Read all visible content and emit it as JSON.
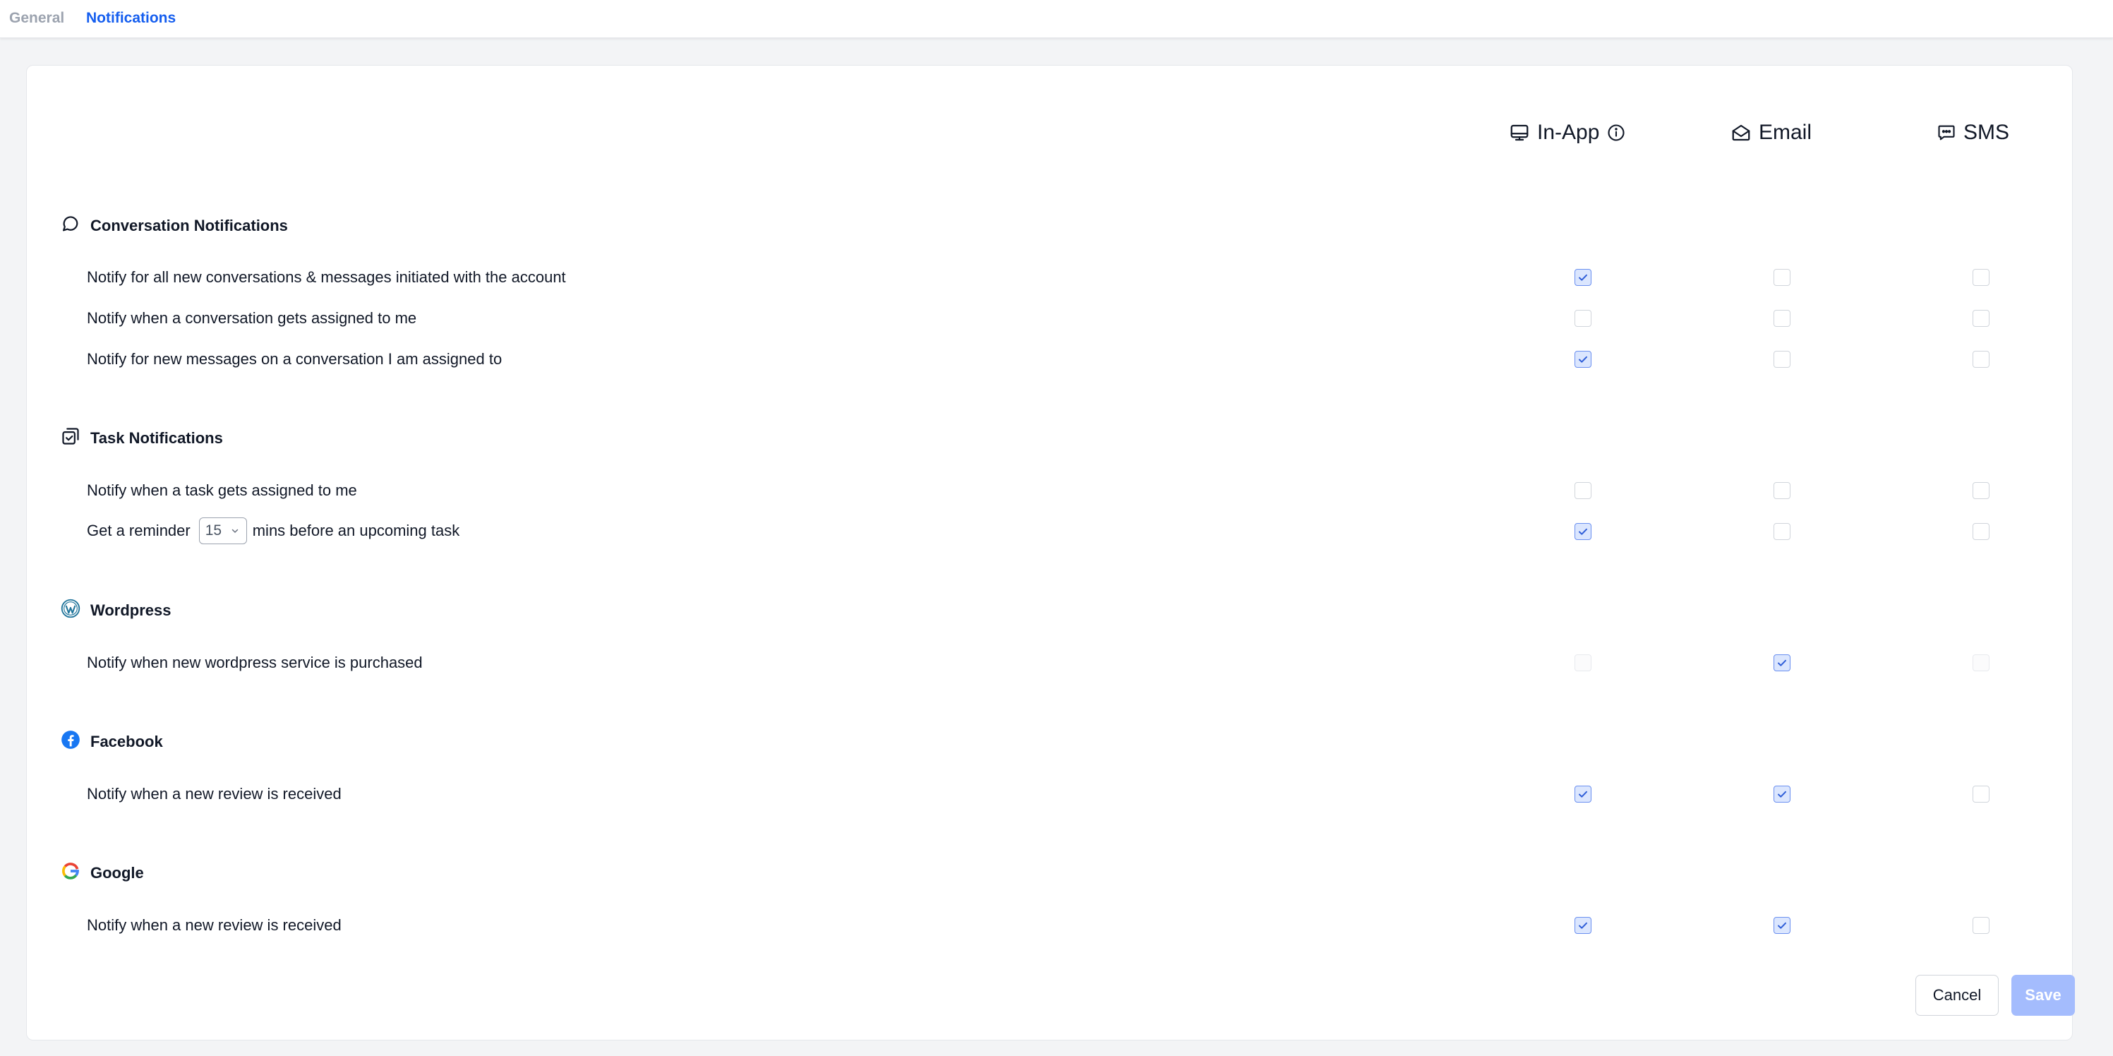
{
  "tabs": [
    {
      "label": "General",
      "active": false
    },
    {
      "label": "Notifications",
      "active": true
    }
  ],
  "channels": {
    "in_app": {
      "label": "In-App",
      "icon": "monitor-icon",
      "info_icon": "info-icon"
    },
    "email": {
      "label": "Email",
      "icon": "envelope-open-icon"
    },
    "sms": {
      "label": "SMS",
      "icon": "chat-dots-icon"
    }
  },
  "sections": {
    "conversation": {
      "title": "Conversation Notifications",
      "icon": "message-circle-icon",
      "rows": [
        {
          "label": "Notify for all new conversations & messages initiated with the account",
          "in_app": "checked",
          "email": "unchecked",
          "sms": "unchecked"
        },
        {
          "label": "Notify when a conversation gets assigned to me",
          "in_app": "unchecked",
          "email": "unchecked",
          "sms": "unchecked"
        },
        {
          "label": "Notify for new messages on a conversation I am assigned to",
          "in_app": "checked",
          "email": "unchecked",
          "sms": "unchecked"
        }
      ]
    },
    "task": {
      "title": "Task Notifications",
      "icon": "task-checkbox-icon",
      "rows": [
        {
          "label": "Notify when a task gets assigned to me",
          "in_app": "unchecked",
          "email": "unchecked",
          "sms": "unchecked"
        },
        {
          "label_before": "Get a reminder",
          "select_value": "15",
          "label_after": "mins before an upcoming task",
          "in_app": "checked",
          "email": "unchecked",
          "sms": "unchecked"
        }
      ]
    },
    "wordpress": {
      "title": "Wordpress",
      "icon": "wordpress-icon",
      "rows": [
        {
          "label": "Notify when new wordpress service is purchased",
          "in_app": "disabled",
          "email": "checked",
          "sms": "disabled"
        }
      ]
    },
    "facebook": {
      "title": "Facebook",
      "icon": "facebook-icon",
      "rows": [
        {
          "label": "Notify when a new review is received",
          "in_app": "checked",
          "email": "checked",
          "sms": "unchecked"
        }
      ]
    },
    "google": {
      "title": "Google",
      "icon": "google-icon",
      "rows": [
        {
          "label": "Notify when a new review is received",
          "in_app": "checked",
          "email": "checked",
          "sms": "unchecked"
        }
      ]
    }
  },
  "actions": {
    "cancel_label": "Cancel",
    "save_label": "Save"
  },
  "colors": {
    "accent": "#155eef",
    "checkbox_checked_fill": "#dbe6fe",
    "checkbox_checked_border": "#6a8ff0",
    "save_disabled": "#a4bcfd",
    "facebook_blue": "#1877f2",
    "wordpress_blue": "#21759b"
  }
}
